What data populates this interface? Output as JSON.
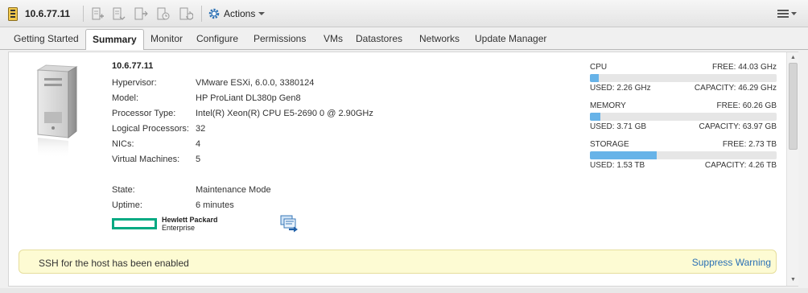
{
  "header": {
    "host_title": "10.6.77.11",
    "actions_label": "Actions",
    "toolbar_icons": [
      "add-host-icon",
      "new-vm-icon",
      "deploy-ovf-icon",
      "new-vapp-icon",
      "migrate-icon"
    ]
  },
  "tabs": [
    {
      "label": "Getting Started",
      "active": false
    },
    {
      "label": "Summary",
      "active": true
    },
    {
      "label": "Monitor",
      "active": false
    },
    {
      "label": "Configure",
      "active": false
    },
    {
      "label": "Permissions",
      "active": false
    },
    {
      "label": "VMs",
      "active": false
    },
    {
      "label": "Datastores",
      "active": false
    },
    {
      "label": "Networks",
      "active": false
    },
    {
      "label": "Update Manager",
      "active": false
    }
  ],
  "summary": {
    "title": "10.6.77.11",
    "rows": [
      {
        "label": "Hypervisor:",
        "value": "VMware ESXi, 6.0.0, 3380124"
      },
      {
        "label": "Model:",
        "value": "HP ProLiant DL380p Gen8"
      },
      {
        "label": "Processor Type:",
        "value": "Intel(R) Xeon(R) CPU E5-2690 0 @ 2.90GHz"
      },
      {
        "label": "Logical Processors:",
        "value": "32"
      },
      {
        "label": "NICs:",
        "value": "4"
      },
      {
        "label": "Virtual Machines:",
        "value": "5"
      },
      {
        "label": "State:",
        "value": "Maintenance Mode"
      },
      {
        "label": "Uptime:",
        "value": "6 minutes"
      }
    ],
    "vendor_logo": {
      "line1": "Hewlett Packard",
      "line2": "Enterprise",
      "color": "#01a982"
    }
  },
  "resources": [
    {
      "name": "CPU",
      "free": "FREE: 44.03 GHz",
      "used": "USED: 2.26 GHz",
      "capacity": "CAPACITY: 46.29 GHz",
      "used_fraction": 0.049
    },
    {
      "name": "MEMORY",
      "free": "FREE: 60.26 GB",
      "used": "USED: 3.71 GB",
      "capacity": "CAPACITY: 63.97 GB",
      "used_fraction": 0.058
    },
    {
      "name": "STORAGE",
      "free": "FREE: 2.73 TB",
      "used": "USED: 1.53 TB",
      "capacity": "CAPACITY: 4.26 TB",
      "used_fraction": 0.359
    }
  ],
  "alert": {
    "message": "SSH for the host has been enabled",
    "action": "Suppress Warning"
  },
  "colors": {
    "accent": "#2a70b5",
    "bar_fill": "#67b3e8",
    "alert_bg": "#fdfbd3"
  }
}
